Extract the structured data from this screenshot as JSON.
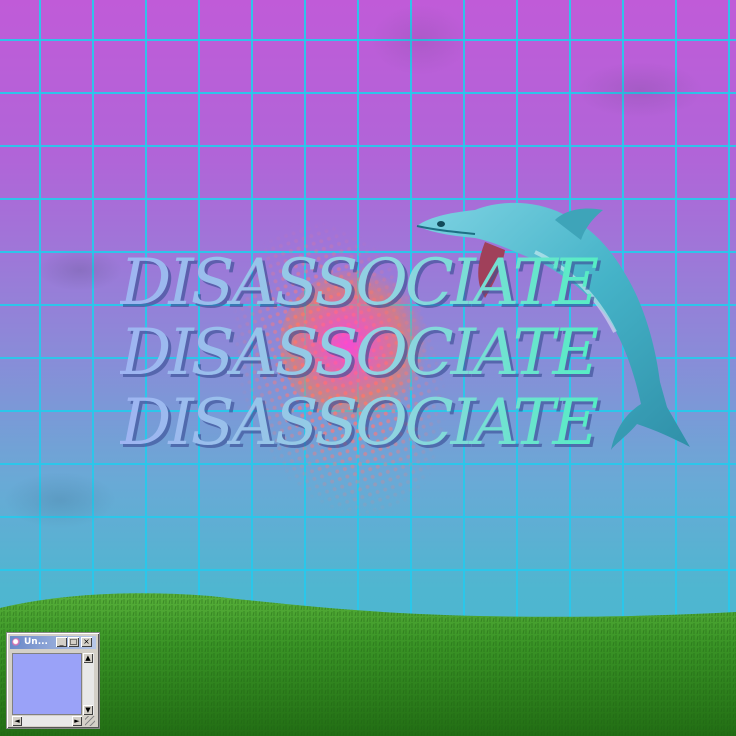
{
  "title_lines": [
    "DISASSOCIATE",
    "DISASSOCIATE",
    "DISASSOCIATE"
  ],
  "mini_window": {
    "title": "Un...",
    "controls": [
      "_",
      "□",
      "×"
    ],
    "scroll_arrows": {
      "up": "▲",
      "down": "▼",
      "left": "◄",
      "right": "►"
    }
  },
  "colors": {
    "sky_top": "#c05bd8",
    "sky_bottom": "#4ab8cc",
    "grid_line": "#28c8eb",
    "dolphin": "#4fbccf",
    "grass": "#2f8a1e",
    "window_body": "#9aa2f8"
  },
  "icons": [
    "app-icon",
    "minimize-icon",
    "maximize-icon",
    "close-icon",
    "scroll-up-icon",
    "scroll-down-icon",
    "scroll-left-icon",
    "scroll-right-icon"
  ]
}
